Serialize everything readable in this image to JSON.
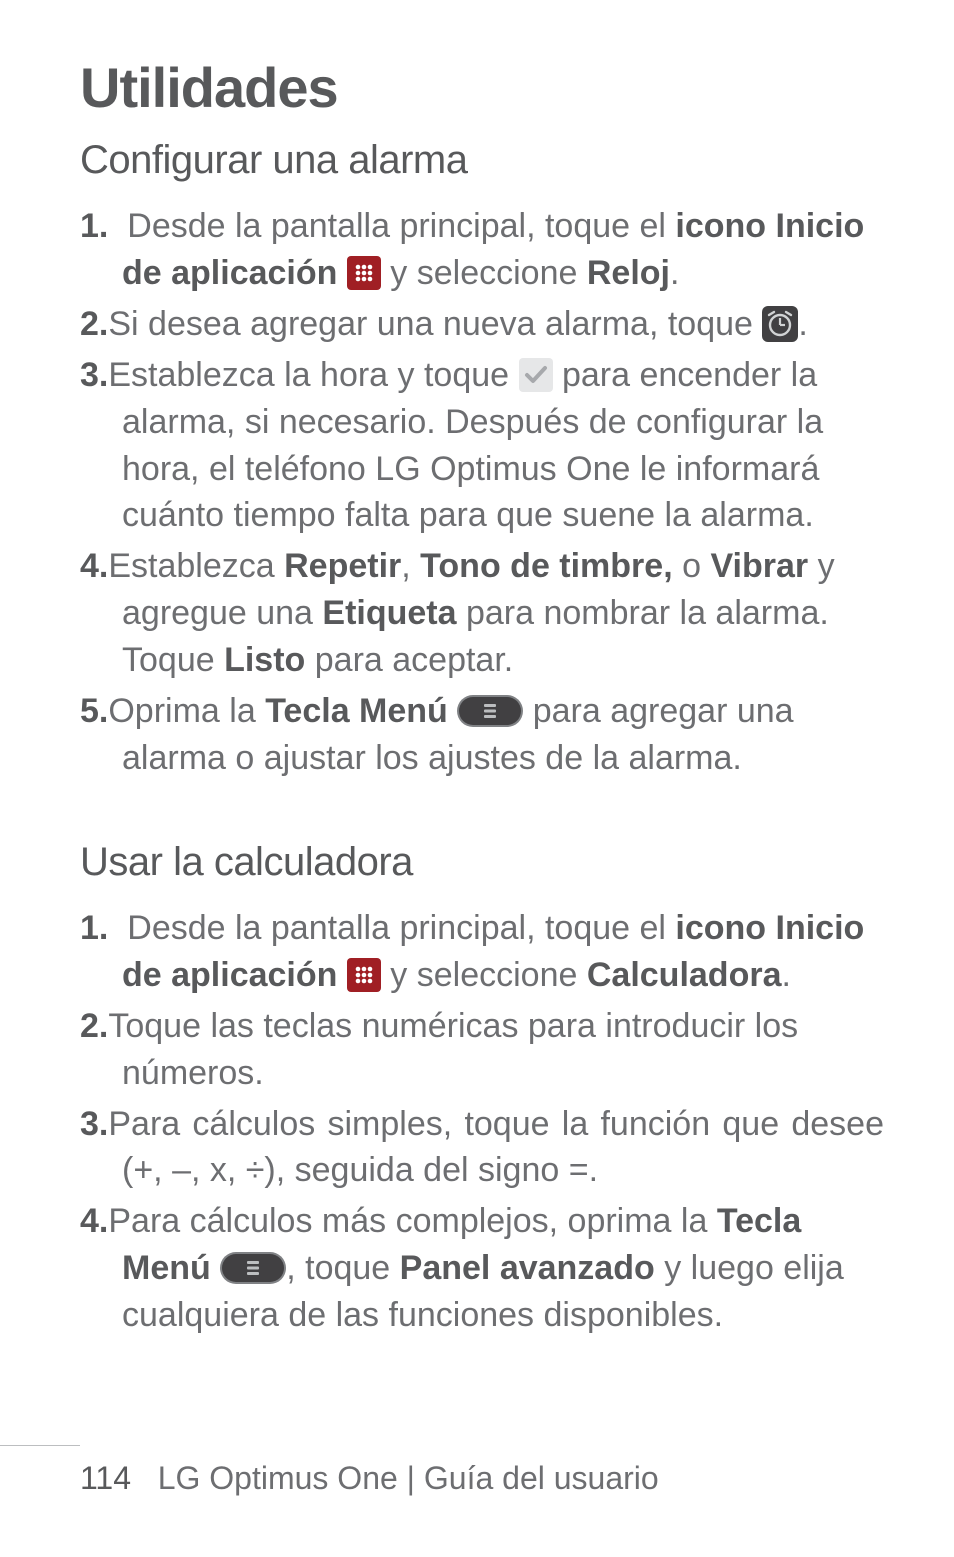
{
  "chapter_title": "Utilidades",
  "section1": {
    "title": "Configurar una alarma",
    "steps": {
      "s1a": "Desde la pantalla principal, toque el ",
      "s1b": "icono Inicio de aplicación",
      "s1c": " y seleccione ",
      "s1d": "Reloj",
      "s1e": ".",
      "s2a": "Si desea agregar una nueva alarma, toque ",
      "s2b": ".",
      "s3a": "Establezca la hora y toque ",
      "s3b": " para encender la alarma, si necesario. Después de configurar la hora, el teléfono LG Optimus One le informará cuánto tiempo falta para que suene la alarma.",
      "s4a": "Establezca ",
      "s4b": "Repetir",
      "s4c": ", ",
      "s4d": "Tono de timbre,",
      "s4e": " o ",
      "s4f": "Vibrar",
      "s4g": " y agregue una ",
      "s4h": "Etiqueta",
      "s4i": " para nombrar la alarma. Toque ",
      "s4j": "Listo",
      "s4k": " para aceptar.",
      "s5a": "Oprima la ",
      "s5b": "Tecla Menú",
      "s5c": " para agregar una alarma o ajustar los ajustes de la alarma."
    }
  },
  "section2": {
    "title": "Usar la calculadora",
    "steps": {
      "s1a": "Desde la pantalla principal, toque el ",
      "s1b": "icono Inicio de aplicación",
      "s1c": " y seleccione ",
      "s1d": "Calculadora",
      "s1e": ".",
      "s2": "Toque las teclas numéricas para introducir los números.",
      "s3": "Para cálculos simples, toque la función que desee (+, –, x, ÷), seguida del signo =.",
      "s4a": "Para cálculos más complejos, oprima la ",
      "s4b": "Tecla Menú",
      "s4c": ", toque ",
      "s4d": "Panel avanzado",
      "s4e": " y luego elija cualquiera de las funciones disponibles."
    }
  },
  "nums": {
    "n1": "1.",
    "n2": "2.",
    "n3": "3.",
    "n4": "4.",
    "n5": "5."
  },
  "footer": {
    "page_number": "114",
    "text": "LG Optimus One | Guía del usuario"
  },
  "icons": {
    "app_launcher": "app-launcher-icon",
    "alarm_clock": "alarm-clock-icon",
    "checkbox": "checkbox-icon",
    "menu_key": "menu-key-icon"
  }
}
